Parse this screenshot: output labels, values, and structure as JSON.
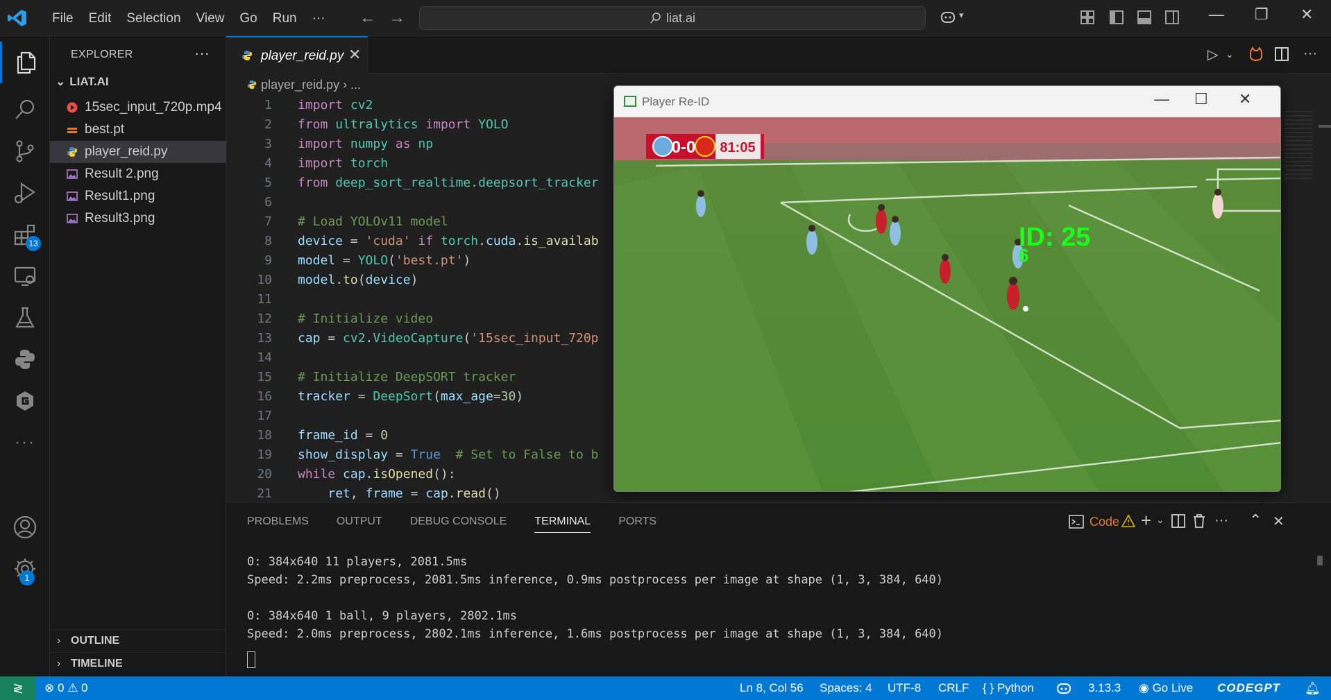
{
  "titlebar": {
    "menu": [
      "File",
      "Edit",
      "Selection",
      "View",
      "Go",
      "Run",
      "···"
    ],
    "command_center": "liat.ai"
  },
  "activitybar": {
    "extensions_badge": "13",
    "settings_badge": "1"
  },
  "sidebar": {
    "title": "EXPLORER",
    "more": "···",
    "folder": "LIAT.AI",
    "files": [
      {
        "name": "15sec_input_720p.mp4",
        "icon": "video-icon",
        "color": "#f14c4c"
      },
      {
        "name": "best.pt",
        "icon": "file-icon",
        "color": "#e37933"
      },
      {
        "name": "player_reid.py",
        "icon": "python-icon",
        "color": "#4b8bbe"
      },
      {
        "name": "Result 2.png",
        "icon": "image-icon",
        "color": "#a074c4"
      },
      {
        "name": "Result1.png",
        "icon": "image-icon",
        "color": "#a074c4"
      },
      {
        "name": "Result3.png",
        "icon": "image-icon",
        "color": "#a074c4"
      }
    ],
    "outline": "OUTLINE",
    "timeline": "TIMELINE"
  },
  "editor": {
    "tab": "player_reid.py",
    "breadcrumb_file": "player_reid.py",
    "breadcrumb_rest": "› ...",
    "line_numbers": [
      "1",
      "2",
      "3",
      "4",
      "5",
      "6",
      "7",
      "8",
      "9",
      "10",
      "11",
      "12",
      "13",
      "14",
      "15",
      "16",
      "17",
      "18",
      "19",
      "20",
      "21"
    ]
  },
  "player_window": {
    "title": "Player Re-ID",
    "score": "0-0",
    "clock": "81:05",
    "id_label": "ID: 25",
    "id_sub": "6"
  },
  "panel": {
    "tabs": [
      "PROBLEMS",
      "OUTPUT",
      "DEBUG CONSOLE",
      "TERMINAL",
      "PORTS"
    ],
    "active_tab": "TERMINAL",
    "terminal_name": "Code",
    "terminal_lines": [
      "0: 384x640 11 players, 2081.5ms",
      "Speed: 2.2ms preprocess, 2081.5ms inference, 0.9ms postprocess per image at shape (1, 3, 384, 640)",
      "",
      "0: 384x640 1 ball, 9 players, 2802.1ms",
      "Speed: 2.0ms preprocess, 2802.1ms inference, 1.6ms postprocess per image at shape (1, 3, 384, 640)"
    ]
  },
  "statusbar": {
    "errors": "0",
    "warnings": "0",
    "position": "Ln 8, Col 56",
    "spaces": "Spaces: 4",
    "encoding": "UTF-8",
    "eol": "CRLF",
    "language": "Python",
    "version": "3.13.3",
    "golive": "Go Live",
    "codegpt": "CODEGPT",
    "color": "#0078d4"
  }
}
